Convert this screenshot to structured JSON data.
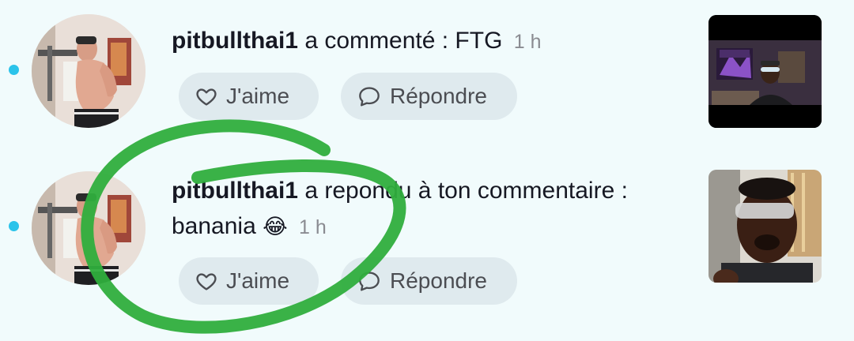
{
  "notifications": [
    {
      "username": "pitbullthai1",
      "action": "a commenté : FTG",
      "time": "1 h",
      "like_label": "J'aime",
      "reply_label": "Répondre"
    },
    {
      "username": "pitbullthai1",
      "action": "a repondu à ton commentaire :",
      "comment": "banania",
      "emoji": "😂",
      "time": "1 h",
      "like_label": "J'aime",
      "reply_label": "Répondre"
    }
  ],
  "icons": {
    "like": "heart-icon",
    "reply": "speech-bubble-icon"
  },
  "colors": {
    "unread_dot": "#2bc3ea",
    "pill_background": "#dfeaee",
    "page_background": "#f1fbfc",
    "annotation_circle": "#2fae3d"
  }
}
